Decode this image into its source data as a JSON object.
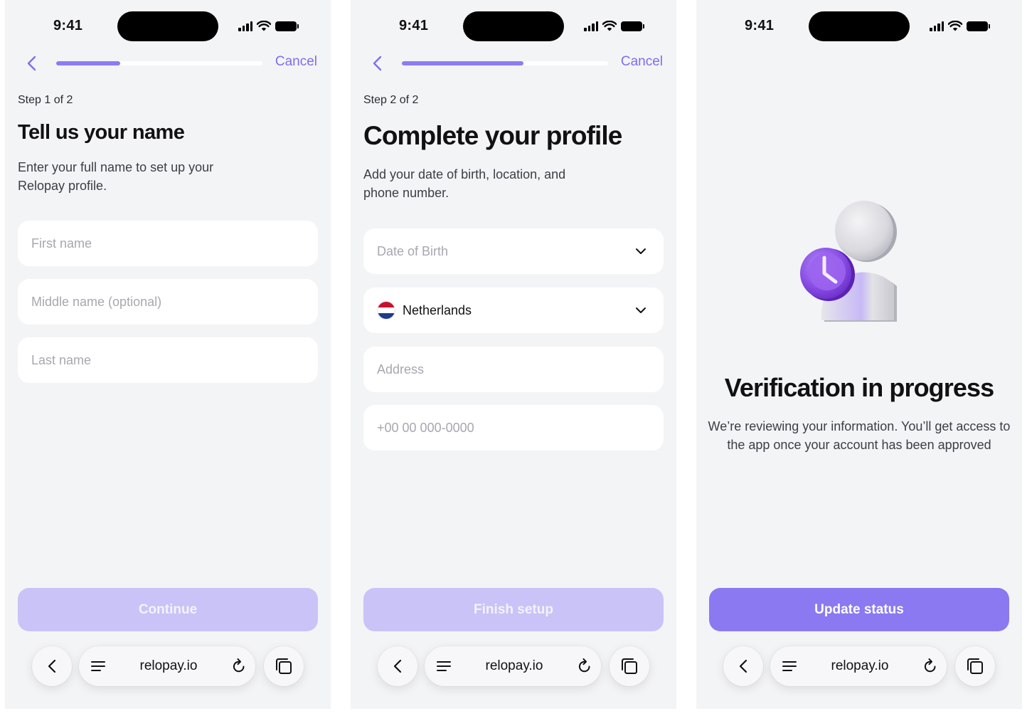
{
  "status_bar": {
    "time": "9:41"
  },
  "browser": {
    "url": "relopay.io"
  },
  "colors": {
    "accent": "#8a79f1",
    "accent_disabled": "#c9c3f7",
    "screen_bg": "#f3f4f6"
  },
  "screen1": {
    "cancel": "Cancel",
    "progress": 0.31,
    "step": "Step 1 of 2",
    "title": "Tell us your name",
    "subtitle": "Enter your full name to set up your Relopay profile.",
    "fields": {
      "first_name": {
        "placeholder": "First name"
      },
      "middle_name": {
        "placeholder": "Middle name (optional)"
      },
      "last_name": {
        "placeholder": "Last name"
      }
    },
    "button": "Continue"
  },
  "screen2": {
    "cancel": "Cancel",
    "progress": 0.59,
    "step": "Step 2 of 2",
    "title": "Complete your profile",
    "subtitle": "Add your date of birth, location, and phone number.",
    "fields": {
      "dob": {
        "placeholder": "Date of Birth"
      },
      "country": {
        "value": "Netherlands"
      },
      "address": {
        "placeholder": "Address"
      },
      "phone": {
        "placeholder": "+00 00 000-0000"
      }
    },
    "button": "Finish setup"
  },
  "screen3": {
    "title": "Verification in progress",
    "text": "We’re reviewing your information. You’ll get access to the app once your account has been approved",
    "button": "Update status"
  }
}
